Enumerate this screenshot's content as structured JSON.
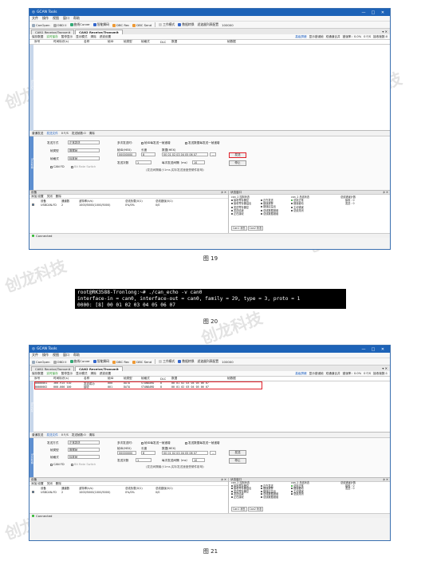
{
  "app": {
    "title": "GCAN Tools",
    "window_controls": [
      "—",
      "□",
      "✕"
    ]
  },
  "menu": [
    "文件",
    "操作",
    "视图",
    "窗口",
    "帮助"
  ],
  "toolbar": {
    "items": [
      "CanOpen",
      "OBD II",
      "曲线Curver",
      "智能解码",
      "DBC Rec",
      "DBC Send",
      "工作模式",
      "数据转换",
      "滤波器列表配置",
      "100000"
    ]
  },
  "tabs": [
    {
      "label": "CAN1 Receive/Transmit",
      "active": false
    },
    {
      "label": "CAN2 Receive/Transmit",
      "active": true
    }
  ],
  "subtool": {
    "left": [
      "保存数据",
      "实时保存",
      "暂停显示",
      "显示模式",
      "清除",
      "滤波设置"
    ],
    "right": [
      "高级屏蔽",
      "显示错误帧",
      "双通道合并",
      "错误率：0.0%",
      "0 F/S",
      "接收帧数:0"
    ],
    "right_fig21": [
      "高级屏蔽",
      "显示错误帧",
      "双通道合并",
      "错误率：0.0%",
      "0 F/S",
      "接收帧数:1"
    ]
  },
  "grid": {
    "columns": [
      "序号",
      "时间标识(s)",
      "名称",
      "帧ID",
      "帧类型",
      "帧格式",
      "DLC",
      "数据",
      "帧数据"
    ],
    "side_label": "Receive",
    "rows_fig21": [
      [
        "00000001",
        "366.915 510",
        "发送成功",
        "000",
        "DATA",
        "STANDARD",
        "8",
        "00 01 02 03 04 05 06 07",
        ""
      ],
      [
        "00000002",
        "000.000 100",
        "接收",
        "001",
        "DATA",
        "STANDARD",
        "8",
        "00 01 02 03 04 05 06 07",
        ""
      ]
    ]
  },
  "sendbar": [
    "普通发送",
    "发送文件",
    "0 F/S",
    "发送帧数:0",
    "清除"
  ],
  "sendpanel": {
    "side_label": "Transmit",
    "send_mode_label": "发送方式",
    "send_mode_value": "正常发送",
    "frame_type_label": "帧类型",
    "frame_type_value": "数据帧",
    "frame_format_label": "帧格式",
    "frame_format_value": "标准帧",
    "can_fd_label": "CAN FD",
    "bit_rate_label": "Bit Rate Switch",
    "multi_send_label": "多次发送时：",
    "id_inc_label": "帧ID每发送一帧递增",
    "data_inc_label": "发送数据每发送一帧递增",
    "frame_id_label": "帧ID(HEX)",
    "frame_id_value": "00000000",
    "length_label": "长度",
    "length_value": "8",
    "data_label": "数据(HEX)",
    "data_value": "00 01 02 03 04 05 06 07",
    "ellipsis": "...",
    "send_count_label": "发送次数",
    "send_count_value": "1",
    "interval_label": "每次发送间隔（ms）",
    "interval_value": "10",
    "hint": "(发送间隔最小1ms,实际发送速度受硬件影响)",
    "send_button": "发送",
    "stop_button": "停止"
  },
  "devpanel": {
    "title": "设备",
    "pin": "⊅ ✕",
    "toolbar": [
      "添加/设置",
      "关闭",
      "删除"
    ],
    "columns": [
      "设备",
      "通道数",
      "波特率(k/s)",
      "总线负载(0/1)",
      "总线错误(0/1)"
    ],
    "row": [
      "USBCAN-FD",
      "2",
      "1000/5000(1000/5000)",
      "0%/0%",
      "0/0"
    ]
  },
  "statuspanel": {
    "title": "状态窗口",
    "pin": "⊅ ✕",
    "col1_title": "can_2 控制状态",
    "col1": [
      "接收寄存器空",
      "接收寄存器溢出",
      "发送寄存器空",
      "发送结束",
      "正在接收"
    ],
    "col2": [
      "正在发送",
      "错误报警",
      "错误区溢出",
      "总线数据错误",
      "总线数据错误"
    ],
    "col3_title": "can_2 总线状态",
    "col3": [
      "总线正常",
      "错误被动",
      "主动错误",
      "总线关闭"
    ],
    "col4_title": "总线错误计数",
    "col4": [
      "接收：0",
      "发送：0"
    ],
    "tabs": [
      "Can1 状态",
      "Can2 状态"
    ]
  },
  "status": {
    "text": "Connected"
  },
  "terminal": {
    "lines": [
      "root@RK3588-Tronlong:~# ./can_echo -v can0",
      "interface-in = can0, interface-out = can0, family = 29, type = 3, proto = 1",
      "0000: [8] 00 01 02 03 04 05 06 07"
    ]
  },
  "captions": [
    "图 19",
    "图 20",
    "图 21"
  ],
  "watermark": "创龙科技",
  "colors": {
    "title_bar": "#1d63b8",
    "highlight": "#e0202a",
    "connected": "#2bb52b"
  }
}
